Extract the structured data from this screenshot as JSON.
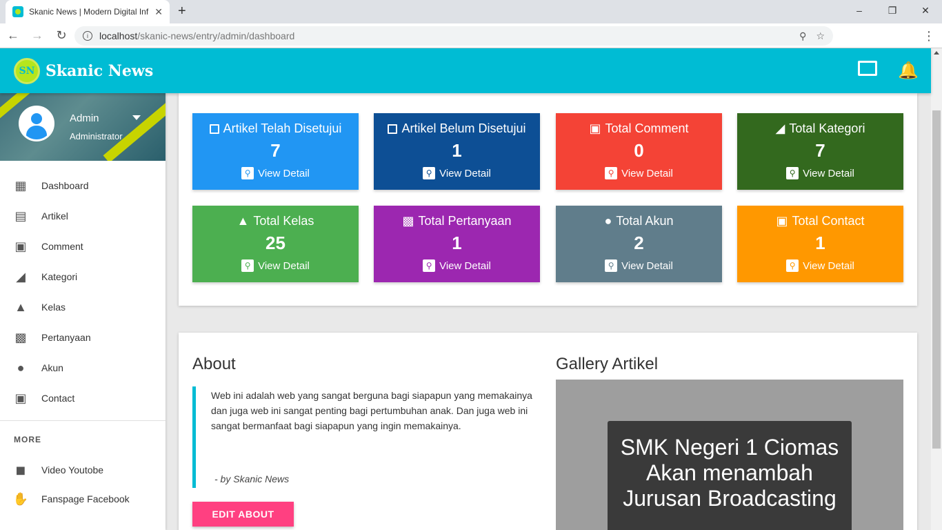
{
  "browser": {
    "tab_title": "Skanic News | Modern Digital Inf",
    "tab_close": "✕",
    "new_tab": "+",
    "url_host": "localhost",
    "url_path": "/skanic-news/entry/admin/dashboard",
    "win_min": "–",
    "win_max": "❐",
    "win_close": "✕"
  },
  "header": {
    "logo_text": "SN",
    "brand": "Skanic News"
  },
  "user": {
    "name": "Admin",
    "role": "Administrator"
  },
  "menu": [
    {
      "label": "Dashboard",
      "icon": "dashboard-icon"
    },
    {
      "label": "Artikel",
      "icon": "library-books-icon"
    },
    {
      "label": "Comment",
      "icon": "comment-icon"
    },
    {
      "label": "Kategori",
      "icon": "tag-icon"
    },
    {
      "label": "Kelas",
      "icon": "bank-icon"
    },
    {
      "label": "Pertanyaan",
      "icon": "forum-icon"
    },
    {
      "label": "Akun",
      "icon": "account-circle-icon"
    },
    {
      "label": "Contact",
      "icon": "contact-icon"
    }
  ],
  "more": {
    "header": "MORE",
    "items": [
      {
        "label": "Video Youtobe",
        "icon": "videocam-icon"
      },
      {
        "label": "Fanspage Facebook",
        "icon": "thumb-up-icon"
      }
    ]
  },
  "stats": [
    {
      "title": "Artikel Telah Disetujui",
      "value": "7",
      "link": "View Detail",
      "color": "#2196f3"
    },
    {
      "title": "Artikel Belum Disetujui",
      "value": "1",
      "link": "View Detail",
      "color": "#0d4f95"
    },
    {
      "title": "Total Comment",
      "value": "0",
      "link": "View Detail",
      "color": "#f44336"
    },
    {
      "title": "Total Kategori",
      "value": "7",
      "link": "View Detail",
      "color": "#33691e"
    },
    {
      "title": "Total Kelas",
      "value": "25",
      "link": "View Detail",
      "color": "#4caf50"
    },
    {
      "title": "Total Pertanyaan",
      "value": "1",
      "link": "View Detail",
      "color": "#9c27b0"
    },
    {
      "title": "Total Akun",
      "value": "2",
      "link": "View Detail",
      "color": "#607d8b"
    },
    {
      "title": "Total Contact",
      "value": "1",
      "link": "View Detail",
      "color": "#ff9800"
    }
  ],
  "about": {
    "heading": "About",
    "text": "Web ini adalah web yang sangat berguna bagi siapapun yang memakainya dan juga web ini sangat penting bagi pertumbuhan anak. Dan juga web ini sangat bermanfaat bagi siapapun yang ingin memakainya.",
    "by": "- by Skanic News",
    "edit_button": "EDIT ABOUT"
  },
  "gallery": {
    "heading": "Gallery Artikel",
    "caption": "SMK Negeri 1 Ciomas Akan menambah Jurusan Broadcasting"
  }
}
